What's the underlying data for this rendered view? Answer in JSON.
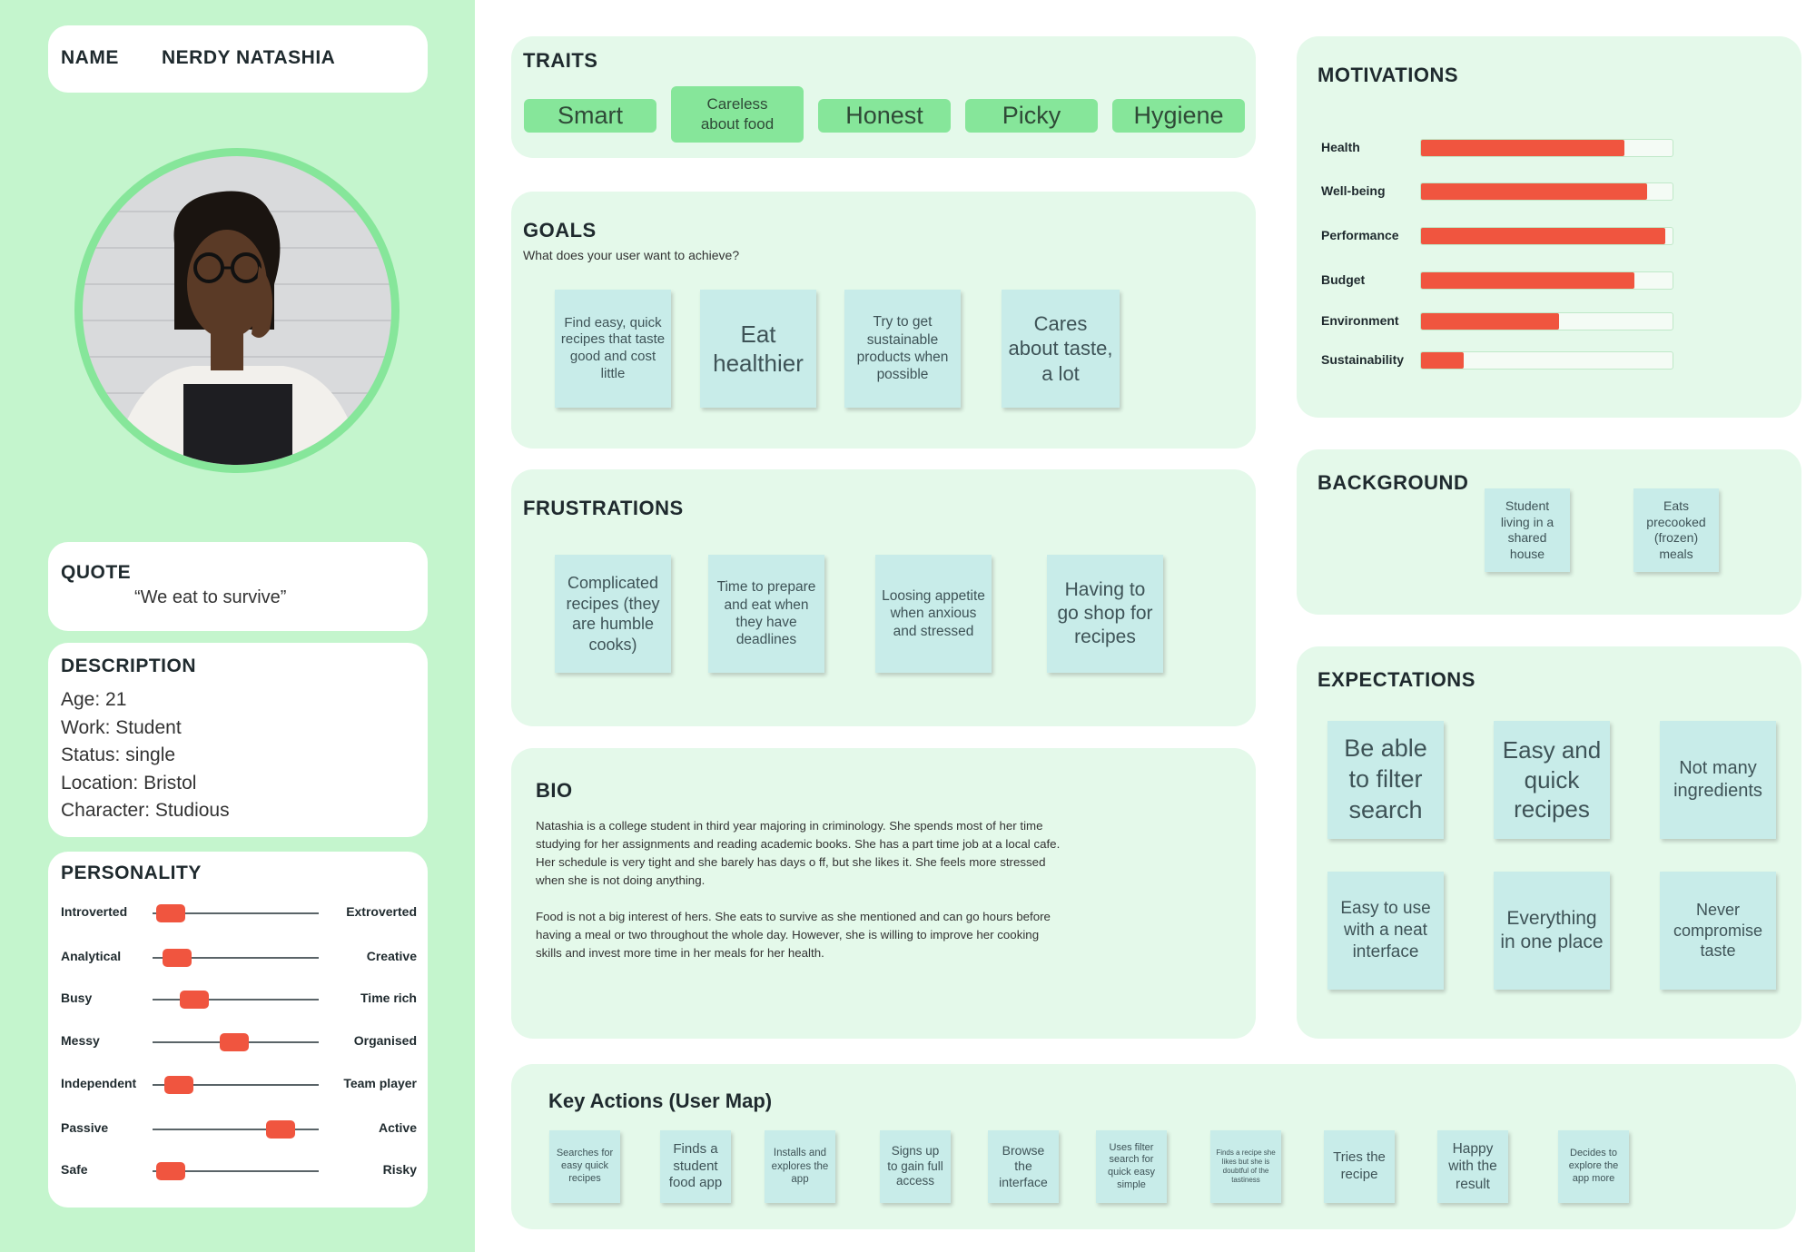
{
  "colors": {
    "sidebar": "#c4f5cd",
    "panel": "#e4f9ea",
    "trait": "#86e69a",
    "sticky": "#c8ece9",
    "accent": "#f0553f"
  },
  "name": {
    "label": "NAME",
    "value": "NERDY NATASHIA"
  },
  "avatar": {
    "icon": "profile-photo"
  },
  "quote": {
    "title": "QUOTE",
    "text": "“We eat to survive”"
  },
  "description": {
    "title": "DESCRIPTION",
    "lines": [
      "Age: 21",
      "Work: Student",
      "Status: single",
      "Location: Bristol",
      "Character: Studious"
    ]
  },
  "personality": {
    "title": "PERSONALITY",
    "rows": [
      {
        "left": "Introverted",
        "right": "Extroverted",
        "value": 0.11
      },
      {
        "left": "Analytical",
        "right": "Creative",
        "value": 0.15
      },
      {
        "left": "Busy",
        "right": "Time rich",
        "value": 0.25
      },
      {
        "left": "Messy",
        "right": "Organised",
        "value": 0.49
      },
      {
        "left": "Independent",
        "right": "Team player",
        "value": 0.16
      },
      {
        "left": "Passive",
        "right": "Active",
        "value": 0.77
      },
      {
        "left": "Safe",
        "right": "Risky",
        "value": 0.11
      }
    ]
  },
  "traits": {
    "title": "TRAITS",
    "items": [
      "Smart",
      "Careless about food",
      "Honest",
      "Picky",
      "Hygiene"
    ]
  },
  "goals": {
    "title": "GOALS",
    "subtitle": "What does your user want to achieve?",
    "items": [
      "Find easy, quick recipes that taste good and cost little",
      "Eat healthier",
      "Try to get sustainable products when possible",
      "Cares about taste, a lot"
    ]
  },
  "frustrations": {
    "title": "FRUSTRATIONS",
    "items": [
      "Complicated recipes (they are humble cooks)",
      "Time to prepare and eat when they have deadlines",
      "Loosing appetite when anxious and stressed",
      "Having to go shop for recipes"
    ]
  },
  "bio": {
    "title": "BIO",
    "paragraphs": [
      "Natashia is a college student in third year majoring in criminology. She spends most of her time studying for her assignments and reading academic books. She has a part time job at a local cafe. Her schedule is very tight and she barely has days o ff, but she likes it. She feels more stressed when she is not doing anything.",
      "Food is not a big interest of hers. She eats to survive as she mentioned and can go hours before having a meal or two throughout the whole day. However, she is willing to improve her cooking skills and invest more time in her meals for her health."
    ]
  },
  "motivations": {
    "title": "MOTIVATIONS",
    "items": [
      {
        "label": "Health",
        "value": 0.81
      },
      {
        "label": "Well-being",
        "value": 0.9
      },
      {
        "label": "Performance",
        "value": 0.97
      },
      {
        "label": "Budget",
        "value": 0.85
      },
      {
        "label": "Environment",
        "value": 0.55
      },
      {
        "label": "Sustainability",
        "value": 0.17
      }
    ]
  },
  "background": {
    "title": "BACKGROUND",
    "items": [
      "Student living in a shared house",
      "Eats precooked (frozen) meals"
    ]
  },
  "expectations": {
    "title": "EXPECTATIONS",
    "items": [
      "Be able to filter search",
      "Easy and quick recipes",
      "Not many ingredients",
      "Easy to use with a neat interface",
      "Everything in one place",
      "Never compromise taste"
    ]
  },
  "key_actions": {
    "title": "Key Actions (User Map)",
    "items": [
      "Searches for easy quick recipes",
      "Finds a student food app",
      "Installs and explores the app",
      "Signs up to gain full access",
      "Browse the interface",
      "Uses filter search for quick easy simple",
      "Finds a recipe she likes but she is doubtful of the tastiness",
      "Tries the recipe",
      "Happy with the result",
      "Decides to explore the app more"
    ]
  }
}
